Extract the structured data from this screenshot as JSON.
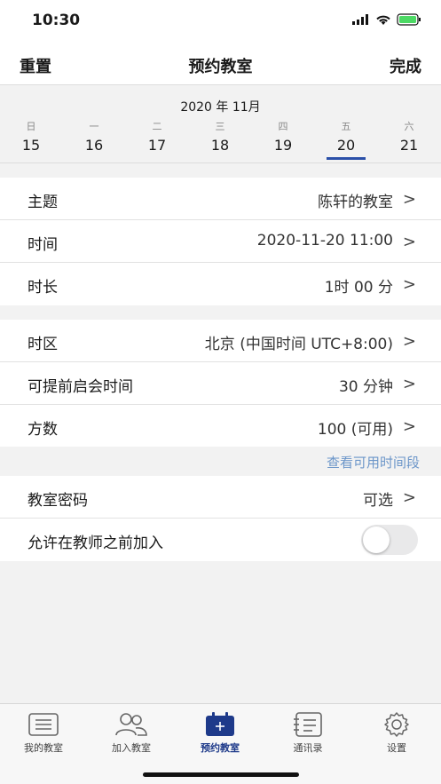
{
  "status_bar": {
    "time": "10:30"
  },
  "nav": {
    "left": "重置",
    "title": "预约教室",
    "right": "完成"
  },
  "calendar": {
    "month": "2020 年 11月",
    "days": [
      {
        "dow": "日",
        "num": "15"
      },
      {
        "dow": "一",
        "num": "16"
      },
      {
        "dow": "二",
        "num": "17"
      },
      {
        "dow": "三",
        "num": "18"
      },
      {
        "dow": "四",
        "num": "19"
      },
      {
        "dow": "五",
        "num": "20"
      },
      {
        "dow": "六",
        "num": "21"
      }
    ],
    "selected": "20"
  },
  "form": {
    "group1": [
      {
        "label": "主题",
        "value": "陈轩的教室"
      },
      {
        "label": "时间",
        "value": "2020-11-20 11:00"
      },
      {
        "label": "时长",
        "value": "1时 00 分"
      }
    ],
    "group2": [
      {
        "label": "时区",
        "value": "北京 (中国时间 UTC+8:00)"
      },
      {
        "label": "可提前启会时间",
        "value": "30 分钟"
      },
      {
        "label": "方数",
        "value": "100 (可用)"
      }
    ],
    "available_link": "查看可用时间段",
    "group3": [
      {
        "label": "教室密码",
        "value": "可选"
      },
      {
        "label": "允许在教师之前加入",
        "toggle_on": false
      }
    ]
  },
  "tabs": [
    {
      "label": "我的教室",
      "icon": "list-icon"
    },
    {
      "label": "加入教室",
      "icon": "people-icon"
    },
    {
      "label": "预约教室",
      "icon": "calendar-add-icon",
      "active": true
    },
    {
      "label": "通讯录",
      "icon": "contacts-icon"
    },
    {
      "label": "设置",
      "icon": "gear-icon"
    }
  ],
  "colors": {
    "accent": "#1e3a8a",
    "link": "#6c96c9",
    "background": "#f2f2f2"
  }
}
